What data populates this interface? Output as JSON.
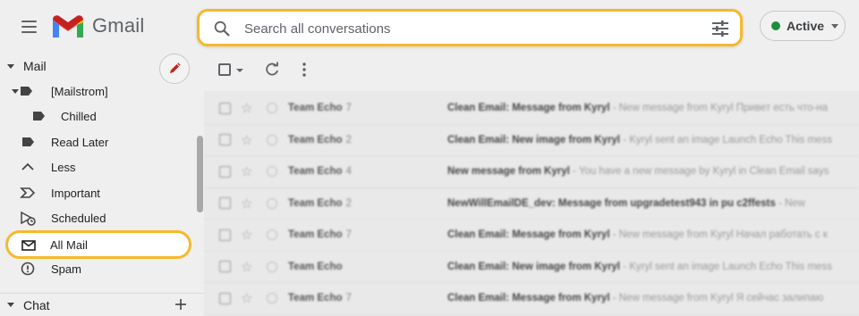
{
  "app": {
    "name": "Gmail"
  },
  "search": {
    "placeholder": "Search all conversations"
  },
  "status": {
    "label": "Active",
    "color": "#1e8e3e"
  },
  "accent": "#f6b92b",
  "sidebar": {
    "mail_header": "Mail",
    "items": [
      {
        "label": "[Mailstrom]",
        "icon": "label-icon"
      },
      {
        "label": "Chilled",
        "icon": "label-icon"
      },
      {
        "label": "Read Later",
        "icon": "label-icon"
      },
      {
        "label": "Less",
        "icon": "chevron-up-icon"
      },
      {
        "label": "Important",
        "icon": "important-icon"
      },
      {
        "label": "Scheduled",
        "icon": "scheduled-icon"
      },
      {
        "label": "All Mail",
        "icon": "mail-icon",
        "selected": true
      },
      {
        "label": "Spam",
        "icon": "spam-icon"
      }
    ],
    "chat_header": "Chat"
  },
  "emails": [
    {
      "sender": "Team Echo",
      "count": "7",
      "subject": "Clean Email: Message from Kyryl",
      "snippet": "- New message from Kyryl Привет есть что-на"
    },
    {
      "sender": "Team Echo",
      "count": "2",
      "subject": "Clean Email: New image from Kyryl",
      "snippet": "- Kyryl sent an image Launch Echo This mess"
    },
    {
      "sender": "Team Echo",
      "count": "4",
      "subject": "New message from Kyryl",
      "snippet": "- You have a new message by Kyryl in Clean Email says"
    },
    {
      "sender": "Team Echo",
      "count": "2",
      "subject": "NewWillEmailDE_dev: Message from upgradetest943 in pu c2ffests",
      "snippet": "- New"
    },
    {
      "sender": "Team Echo",
      "count": "7",
      "subject": "Clean Email: Message from Kyryl",
      "snippet": "- New message from Kyryl Начал работать с к"
    },
    {
      "sender": "Team Echo",
      "count": "",
      "subject": "Clean Email: New image from Kyryl",
      "snippet": "- Kyryl sent an image Launch Echo This mess"
    },
    {
      "sender": "Team Echo",
      "count": "7",
      "subject": "Clean Email: Message from Kyryl",
      "snippet": "- New message from Kyryl Я сейчас залипаю"
    }
  ]
}
